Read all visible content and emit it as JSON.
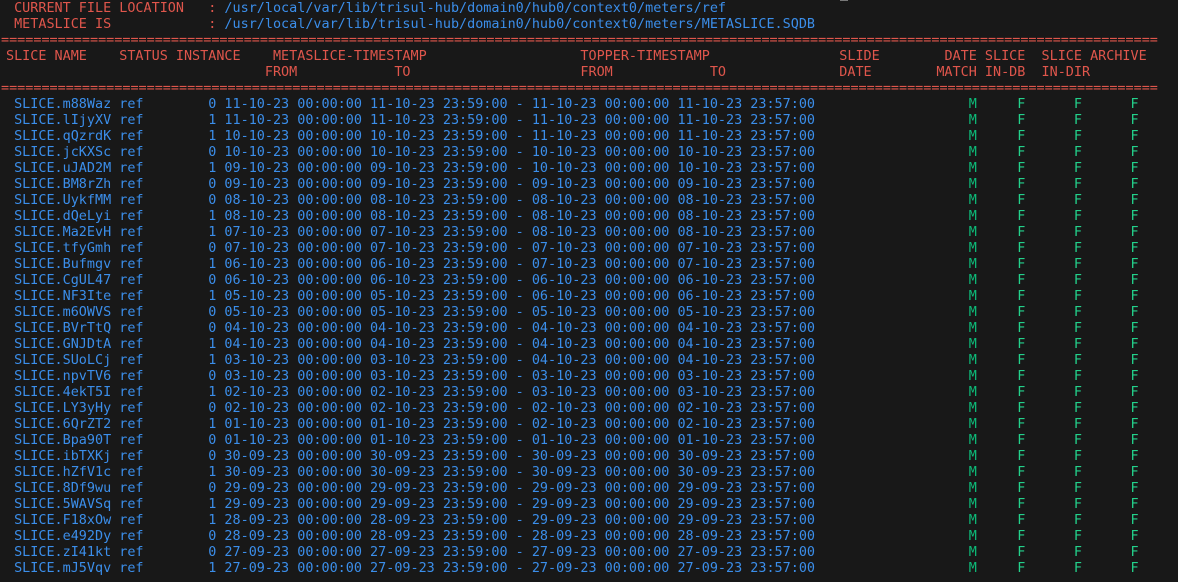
{
  "info": {
    "location_label": "CURRENT FILE LOCATION",
    "location_value": "/usr/local/var/lib/trisul-hub/domain0/hub0/context0/meters/ref",
    "metaslice_label": "METASLICE IS",
    "metaslice_value": "/usr/local/var/lib/trisul-hub/domain0/hub0/context0/meters/METASLICE.SQDB",
    "colon": ":"
  },
  "separator": "===============================================================================================================================================",
  "headers": {
    "slice_name": "SLICE NAME",
    "status_instance": "STATUS INSTANCE",
    "metaslice_timestamp": "METASLICE-TIMESTAMP",
    "meta_from": "FROM",
    "meta_to": "TO",
    "topper_timestamp": "TOPPER-TIMESTAMP",
    "topper_from": "FROM",
    "topper_to": "TO",
    "slide": "SLIDE",
    "slide_date": "DATE",
    "date": "DATE",
    "match": "MATCH",
    "slice1": "SLICE",
    "in_db": "IN-DB",
    "slice2": "SLICE",
    "in_dir": "IN-DIR",
    "archive": "ARCHIVE"
  },
  "colors": {
    "header": "#e0564c",
    "value": "#3b8eea",
    "match": "#0dbc79",
    "flag": "#23d18b",
    "background": "#181818"
  },
  "rows": [
    {
      "name": "SLICE.m88Waz",
      "status": "ref",
      "instance": "0",
      "meta_from": "11-10-23 00:00:00",
      "meta_to": "11-10-23 23:59:00",
      "dash": "-",
      "top_from": "11-10-23 00:00:00",
      "top_to": "11-10-23 23:57:00",
      "match": "M",
      "in_db": "F",
      "in_dir": "F",
      "archive": "F"
    },
    {
      "name": "SLICE.lIjyXV",
      "status": "ref",
      "instance": "1",
      "meta_from": "11-10-23 00:00:00",
      "meta_to": "11-10-23 23:59:00",
      "dash": "-",
      "top_from": "11-10-23 00:00:00",
      "top_to": "11-10-23 23:57:00",
      "match": "M",
      "in_db": "F",
      "in_dir": "F",
      "archive": "F"
    },
    {
      "name": "SLICE.qQzrdK",
      "status": "ref",
      "instance": "1",
      "meta_from": "10-10-23 00:00:00",
      "meta_to": "10-10-23 23:59:00",
      "dash": "-",
      "top_from": "11-10-23 00:00:00",
      "top_to": "11-10-23 23:57:00",
      "match": "M",
      "in_db": "F",
      "in_dir": "F",
      "archive": "F"
    },
    {
      "name": "SLICE.jcKXSc",
      "status": "ref",
      "instance": "0",
      "meta_from": "10-10-23 00:00:00",
      "meta_to": "10-10-23 23:59:00",
      "dash": "-",
      "top_from": "10-10-23 00:00:00",
      "top_to": "10-10-23 23:57:00",
      "match": "M",
      "in_db": "F",
      "in_dir": "F",
      "archive": "F"
    },
    {
      "name": "SLICE.uJAD2M",
      "status": "ref",
      "instance": "1",
      "meta_from": "09-10-23 00:00:00",
      "meta_to": "09-10-23 23:59:00",
      "dash": "-",
      "top_from": "10-10-23 00:00:00",
      "top_to": "10-10-23 23:57:00",
      "match": "M",
      "in_db": "F",
      "in_dir": "F",
      "archive": "F"
    },
    {
      "name": "SLICE.BM8rZh",
      "status": "ref",
      "instance": "0",
      "meta_from": "09-10-23 00:00:00",
      "meta_to": "09-10-23 23:59:00",
      "dash": "-",
      "top_from": "09-10-23 00:00:00",
      "top_to": "09-10-23 23:57:00",
      "match": "M",
      "in_db": "F",
      "in_dir": "F",
      "archive": "F"
    },
    {
      "name": "SLICE.UykfMM",
      "status": "ref",
      "instance": "0",
      "meta_from": "08-10-23 00:00:00",
      "meta_to": "08-10-23 23:59:00",
      "dash": "-",
      "top_from": "08-10-23 00:00:00",
      "top_to": "08-10-23 23:57:00",
      "match": "M",
      "in_db": "F",
      "in_dir": "F",
      "archive": "F"
    },
    {
      "name": "SLICE.dQeLyi",
      "status": "ref",
      "instance": "1",
      "meta_from": "08-10-23 00:00:00",
      "meta_to": "08-10-23 23:59:00",
      "dash": "-",
      "top_from": "08-10-23 00:00:00",
      "top_to": "08-10-23 23:57:00",
      "match": "M",
      "in_db": "F",
      "in_dir": "F",
      "archive": "F"
    },
    {
      "name": "SLICE.Ma2EvH",
      "status": "ref",
      "instance": "1",
      "meta_from": "07-10-23 00:00:00",
      "meta_to": "07-10-23 23:59:00",
      "dash": "-",
      "top_from": "08-10-23 00:00:00",
      "top_to": "08-10-23 23:57:00",
      "match": "M",
      "in_db": "F",
      "in_dir": "F",
      "archive": "F"
    },
    {
      "name": "SLICE.tfyGmh",
      "status": "ref",
      "instance": "0",
      "meta_from": "07-10-23 00:00:00",
      "meta_to": "07-10-23 23:59:00",
      "dash": "-",
      "top_from": "07-10-23 00:00:00",
      "top_to": "07-10-23 23:57:00",
      "match": "M",
      "in_db": "F",
      "in_dir": "F",
      "archive": "F"
    },
    {
      "name": "SLICE.Bufmgv",
      "status": "ref",
      "instance": "1",
      "meta_from": "06-10-23 00:00:00",
      "meta_to": "06-10-23 23:59:00",
      "dash": "-",
      "top_from": "07-10-23 00:00:00",
      "top_to": "07-10-23 23:57:00",
      "match": "M",
      "in_db": "F",
      "in_dir": "F",
      "archive": "F"
    },
    {
      "name": "SLICE.CgUL47",
      "status": "ref",
      "instance": "0",
      "meta_from": "06-10-23 00:00:00",
      "meta_to": "06-10-23 23:59:00",
      "dash": "-",
      "top_from": "06-10-23 00:00:00",
      "top_to": "06-10-23 23:57:00",
      "match": "M",
      "in_db": "F",
      "in_dir": "F",
      "archive": "F"
    },
    {
      "name": "SLICE.NF3Ite",
      "status": "ref",
      "instance": "1",
      "meta_from": "05-10-23 00:00:00",
      "meta_to": "05-10-23 23:59:00",
      "dash": "-",
      "top_from": "06-10-23 00:00:00",
      "top_to": "06-10-23 23:57:00",
      "match": "M",
      "in_db": "F",
      "in_dir": "F",
      "archive": "F"
    },
    {
      "name": "SLICE.m6OWVS",
      "status": "ref",
      "instance": "0",
      "meta_from": "05-10-23 00:00:00",
      "meta_to": "05-10-23 23:59:00",
      "dash": "-",
      "top_from": "05-10-23 00:00:00",
      "top_to": "05-10-23 23:57:00",
      "match": "M",
      "in_db": "F",
      "in_dir": "F",
      "archive": "F"
    },
    {
      "name": "SLICE.BVrTtQ",
      "status": "ref",
      "instance": "0",
      "meta_from": "04-10-23 00:00:00",
      "meta_to": "04-10-23 23:59:00",
      "dash": "-",
      "top_from": "04-10-23 00:00:00",
      "top_to": "04-10-23 23:57:00",
      "match": "M",
      "in_db": "F",
      "in_dir": "F",
      "archive": "F"
    },
    {
      "name": "SLICE.GNJDtA",
      "status": "ref",
      "instance": "1",
      "meta_from": "04-10-23 00:00:00",
      "meta_to": "04-10-23 23:59:00",
      "dash": "-",
      "top_from": "04-10-23 00:00:00",
      "top_to": "04-10-23 23:57:00",
      "match": "M",
      "in_db": "F",
      "in_dir": "F",
      "archive": "F"
    },
    {
      "name": "SLICE.SUoLCj",
      "status": "ref",
      "instance": "1",
      "meta_from": "03-10-23 00:00:00",
      "meta_to": "03-10-23 23:59:00",
      "dash": "-",
      "top_from": "04-10-23 00:00:00",
      "top_to": "04-10-23 23:57:00",
      "match": "M",
      "in_db": "F",
      "in_dir": "F",
      "archive": "F"
    },
    {
      "name": "SLICE.npvTV6",
      "status": "ref",
      "instance": "0",
      "meta_from": "03-10-23 00:00:00",
      "meta_to": "03-10-23 23:59:00",
      "dash": "-",
      "top_from": "03-10-23 00:00:00",
      "top_to": "03-10-23 23:57:00",
      "match": "M",
      "in_db": "F",
      "in_dir": "F",
      "archive": "F"
    },
    {
      "name": "SLICE.4ekT5I",
      "status": "ref",
      "instance": "1",
      "meta_from": "02-10-23 00:00:00",
      "meta_to": "02-10-23 23:59:00",
      "dash": "-",
      "top_from": "03-10-23 00:00:00",
      "top_to": "03-10-23 23:57:00",
      "match": "M",
      "in_db": "F",
      "in_dir": "F",
      "archive": "F"
    },
    {
      "name": "SLICE.LY3yHy",
      "status": "ref",
      "instance": "0",
      "meta_from": "02-10-23 00:00:00",
      "meta_to": "02-10-23 23:59:00",
      "dash": "-",
      "top_from": "02-10-23 00:00:00",
      "top_to": "02-10-23 23:57:00",
      "match": "M",
      "in_db": "F",
      "in_dir": "F",
      "archive": "F"
    },
    {
      "name": "SLICE.6QrZT2",
      "status": "ref",
      "instance": "1",
      "meta_from": "01-10-23 00:00:00",
      "meta_to": "01-10-23 23:59:00",
      "dash": "-",
      "top_from": "02-10-23 00:00:00",
      "top_to": "02-10-23 23:57:00",
      "match": "M",
      "in_db": "F",
      "in_dir": "F",
      "archive": "F"
    },
    {
      "name": "SLICE.Bpa90T",
      "status": "ref",
      "instance": "0",
      "meta_from": "01-10-23 00:00:00",
      "meta_to": "01-10-23 23:59:00",
      "dash": "-",
      "top_from": "01-10-23 00:00:00",
      "top_to": "01-10-23 23:57:00",
      "match": "M",
      "in_db": "F",
      "in_dir": "F",
      "archive": "F"
    },
    {
      "name": "SLICE.ibTXKj",
      "status": "ref",
      "instance": "0",
      "meta_from": "30-09-23 00:00:00",
      "meta_to": "30-09-23 23:59:00",
      "dash": "-",
      "top_from": "30-09-23 00:00:00",
      "top_to": "30-09-23 23:57:00",
      "match": "M",
      "in_db": "F",
      "in_dir": "F",
      "archive": "F"
    },
    {
      "name": "SLICE.hZfV1c",
      "status": "ref",
      "instance": "1",
      "meta_from": "30-09-23 00:00:00",
      "meta_to": "30-09-23 23:59:00",
      "dash": "-",
      "top_from": "30-09-23 00:00:00",
      "top_to": "30-09-23 23:57:00",
      "match": "M",
      "in_db": "F",
      "in_dir": "F",
      "archive": "F"
    },
    {
      "name": "SLICE.8Df9wu",
      "status": "ref",
      "instance": "0",
      "meta_from": "29-09-23 00:00:00",
      "meta_to": "29-09-23 23:59:00",
      "dash": "-",
      "top_from": "29-09-23 00:00:00",
      "top_to": "29-09-23 23:57:00",
      "match": "M",
      "in_db": "F",
      "in_dir": "F",
      "archive": "F"
    },
    {
      "name": "SLICE.5WAVSq",
      "status": "ref",
      "instance": "1",
      "meta_from": "29-09-23 00:00:00",
      "meta_to": "29-09-23 23:59:00",
      "dash": "-",
      "top_from": "29-09-23 00:00:00",
      "top_to": "29-09-23 23:57:00",
      "match": "M",
      "in_db": "F",
      "in_dir": "F",
      "archive": "F"
    },
    {
      "name": "SLICE.F18xOw",
      "status": "ref",
      "instance": "1",
      "meta_from": "28-09-23 00:00:00",
      "meta_to": "28-09-23 23:59:00",
      "dash": "-",
      "top_from": "29-09-23 00:00:00",
      "top_to": "29-09-23 23:57:00",
      "match": "M",
      "in_db": "F",
      "in_dir": "F",
      "archive": "F"
    },
    {
      "name": "SLICE.e492Dy",
      "status": "ref",
      "instance": "0",
      "meta_from": "28-09-23 00:00:00",
      "meta_to": "28-09-23 23:59:00",
      "dash": "-",
      "top_from": "28-09-23 00:00:00",
      "top_to": "28-09-23 23:57:00",
      "match": "M",
      "in_db": "F",
      "in_dir": "F",
      "archive": "F"
    },
    {
      "name": "SLICE.zI41kt",
      "status": "ref",
      "instance": "0",
      "meta_from": "27-09-23 00:00:00",
      "meta_to": "27-09-23 23:59:00",
      "dash": "-",
      "top_from": "27-09-23 00:00:00",
      "top_to": "27-09-23 23:57:00",
      "match": "M",
      "in_db": "F",
      "in_dir": "F",
      "archive": "F"
    },
    {
      "name": "SLICE.mJ5Vqv",
      "status": "ref",
      "instance": "1",
      "meta_from": "27-09-23 00:00:00",
      "meta_to": "27-09-23 23:59:00",
      "dash": "-",
      "top_from": "27-09-23 00:00:00",
      "top_to": "27-09-23 23:57:00",
      "match": "M",
      "in_db": "F",
      "in_dir": "F",
      "archive": "F"
    }
  ]
}
